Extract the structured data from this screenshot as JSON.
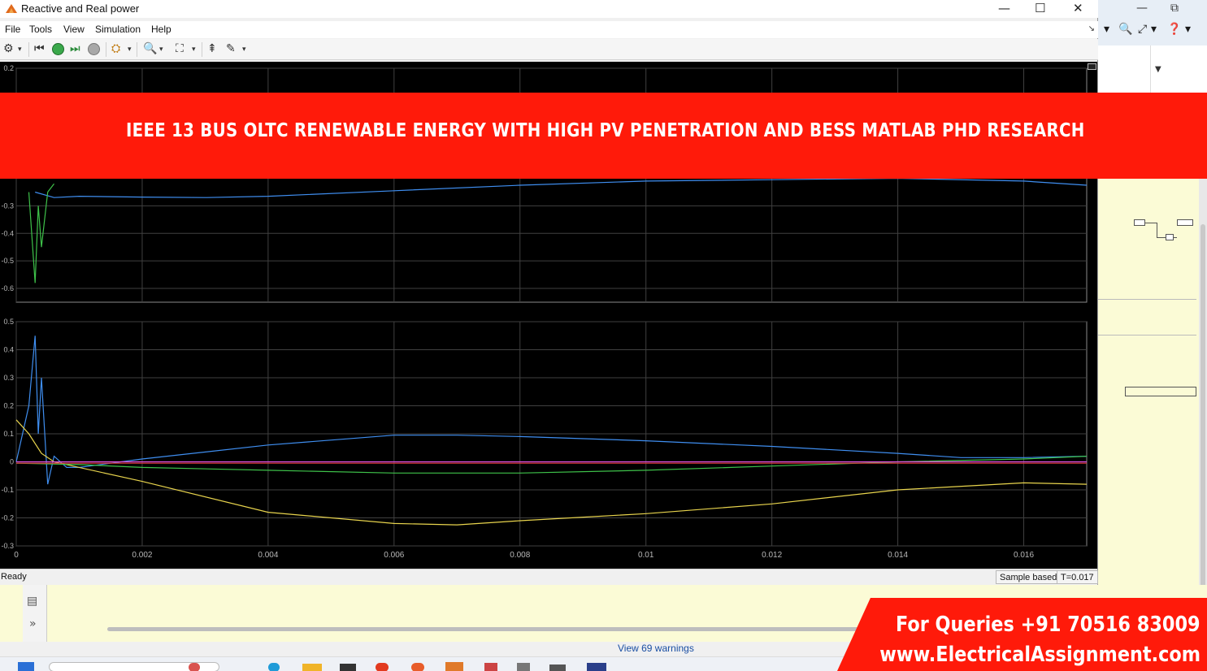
{
  "window": {
    "title": "Reactive and Real power",
    "minimize": "—",
    "maximize": "☐",
    "close": "✕"
  },
  "menu": [
    "File",
    "Tools",
    "View",
    "Simulation",
    "Help"
  ],
  "status": {
    "ready": "Ready",
    "mode": "Sample based",
    "time": "T=0.017"
  },
  "background_app": {
    "warnings_link": "View 69 warnings"
  },
  "overlay": {
    "banner": "IEEE 13 BUS OLTC RENEWABLE ENERGY WITH HIGH PV PENETRATION AND BESS MATLAB PHD RESEARCH",
    "queries": "For Queries +91 70516 83009",
    "website": "www.ElectricalAssignment.com"
  },
  "icons": [
    "settings-icon",
    "rewind-icon",
    "run-icon",
    "step-forward-icon",
    "stop-icon",
    "highlight-icon",
    "zoom-icon",
    "fit-to-view-icon",
    "triggers-icon",
    "style-icon"
  ],
  "colors": {
    "plot_bg": "#000000",
    "grid": "#404040",
    "banner": "#ff1a0a",
    "series_blue": "#3f8ef0",
    "series_yellow": "#e8d44d",
    "series_green": "#3ec24a",
    "series_magenta": "#d94fe0",
    "series_red": "#e03a3a"
  },
  "chart_data": [
    {
      "type": "line",
      "ylim": [
        -0.6,
        0.2
      ],
      "y_ticks": [
        "0.2",
        "-0.3",
        "-0.4",
        "-0.5",
        "-0.6"
      ],
      "x_grid": [
        0,
        0.002,
        0.004,
        0.006,
        0.008,
        0.01,
        0.012,
        0.014,
        0.016
      ],
      "series": [
        {
          "color": "#3f8ef0",
          "x": [
            0.0003,
            0.0006,
            0.001,
            0.002,
            0.003,
            0.004,
            0.006,
            0.008,
            0.01,
            0.012,
            0.014,
            0.016,
            0.017
          ],
          "y": [
            -0.25,
            -0.27,
            -0.265,
            -0.268,
            -0.27,
            -0.265,
            -0.245,
            -0.225,
            -0.21,
            -0.205,
            -0.2,
            -0.21,
            -0.225
          ]
        },
        {
          "color": "#3ec24a",
          "x": [
            0.0002,
            0.0003,
            0.00035,
            0.0004,
            0.0005,
            0.0006
          ],
          "y": [
            -0.25,
            -0.58,
            -0.3,
            -0.45,
            -0.25,
            -0.22
          ]
        }
      ]
    },
    {
      "type": "line",
      "xlim": [
        0,
        0.017
      ],
      "ylim": [
        -0.3,
        0.5
      ],
      "x_ticks": [
        "0",
        "0.002",
        "0.004",
        "0.006",
        "0.008",
        "0.01",
        "0.012",
        "0.014",
        "0.016"
      ],
      "y_ticks": [
        "0.5",
        "0.4",
        "0.3",
        "0.2",
        "0.1",
        "0",
        "-0.1",
        "-0.2",
        "-0.3"
      ],
      "series": [
        {
          "color": "#3f8ef0",
          "x": [
            0,
            0.0002,
            0.0003,
            0.00035,
            0.0004,
            0.0005,
            0.0006,
            0.0008,
            0.001,
            0.002,
            0.004,
            0.006,
            0.007,
            0.008,
            0.01,
            0.012,
            0.014,
            0.015,
            0.016,
            0.017
          ],
          "y": [
            0,
            0.2,
            0.45,
            0.1,
            0.3,
            -0.08,
            0.02,
            -0.02,
            -0.02,
            0.01,
            0.06,
            0.095,
            0.095,
            0.09,
            0.075,
            0.055,
            0.03,
            0.015,
            0.015,
            0.02
          ]
        },
        {
          "color": "#e8d44d",
          "x": [
            0,
            0.0002,
            0.0004,
            0.0006,
            0.001,
            0.002,
            0.004,
            0.006,
            0.007,
            0.008,
            0.01,
            0.012,
            0.014,
            0.016,
            0.017
          ],
          "y": [
            0.15,
            0.1,
            0.03,
            0.0,
            -0.02,
            -0.07,
            -0.18,
            -0.22,
            -0.225,
            -0.21,
            -0.185,
            -0.15,
            -0.1,
            -0.075,
            -0.08
          ]
        },
        {
          "color": "#3ec24a",
          "x": [
            0,
            0.001,
            0.002,
            0.004,
            0.006,
            0.008,
            0.01,
            0.012,
            0.014,
            0.016,
            0.017
          ],
          "y": [
            -0.005,
            -0.01,
            -0.02,
            -0.03,
            -0.04,
            -0.04,
            -0.03,
            -0.015,
            0.0,
            0.01,
            0.02
          ]
        },
        {
          "color": "#d94fe0",
          "x": [
            0,
            0.017
          ],
          "y": [
            0.0,
            0.0
          ]
        },
        {
          "color": "#e03a3a",
          "x": [
            0,
            0.017
          ],
          "y": [
            -0.005,
            -0.005
          ]
        }
      ]
    }
  ]
}
